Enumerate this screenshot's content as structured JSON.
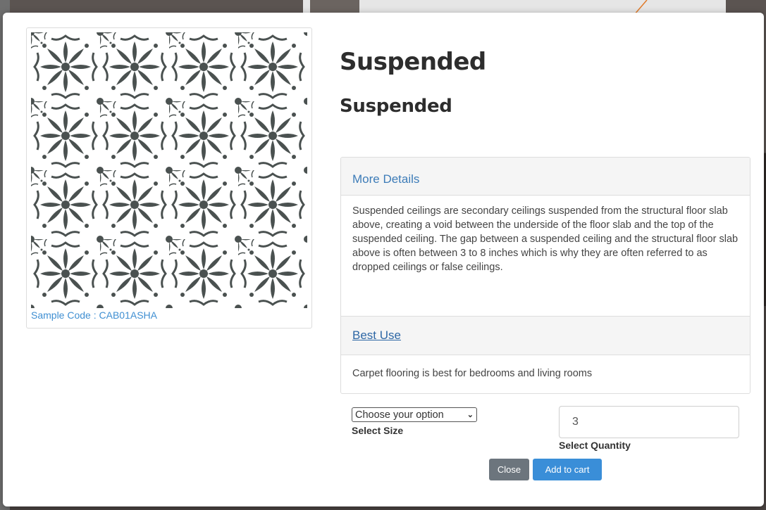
{
  "product": {
    "title": "Suspended",
    "subtitle": "Suspended",
    "sample_code": "Sample Code : CAB01ASHA"
  },
  "details": {
    "more_details_heading": "More Details",
    "more_details_text": "Suspended ceilings are secondary ceilings suspended from the structural floor slab above, creating a void between the underside of the floor slab and the top of the suspended ceiling. The gap between a suspended ceiling and the structural floor slab above is often between 3 to 8 inches which is why they are often referred to as dropped ceilings or false ceilings.",
    "best_use_heading": "Best Use",
    "best_use_text": "Carpet flooring is best for bedrooms and living rooms"
  },
  "form": {
    "size_select_value": "Choose your option",
    "size_label": "Select Size",
    "quantity_value": "3",
    "quantity_label": "Select Quantity"
  },
  "buttons": {
    "close_label": "Close",
    "add_to_cart_label": "Add to cart"
  },
  "colors": {
    "pattern": "#4a5150",
    "link": "#3d7cb8",
    "close_button": "#6c757d",
    "cart_button": "#3a8ed8",
    "annotation_arrow": "#e07b2a"
  },
  "icons": {
    "select_chevron": "chevron-down-icon",
    "annotation": "arrow-icon"
  }
}
